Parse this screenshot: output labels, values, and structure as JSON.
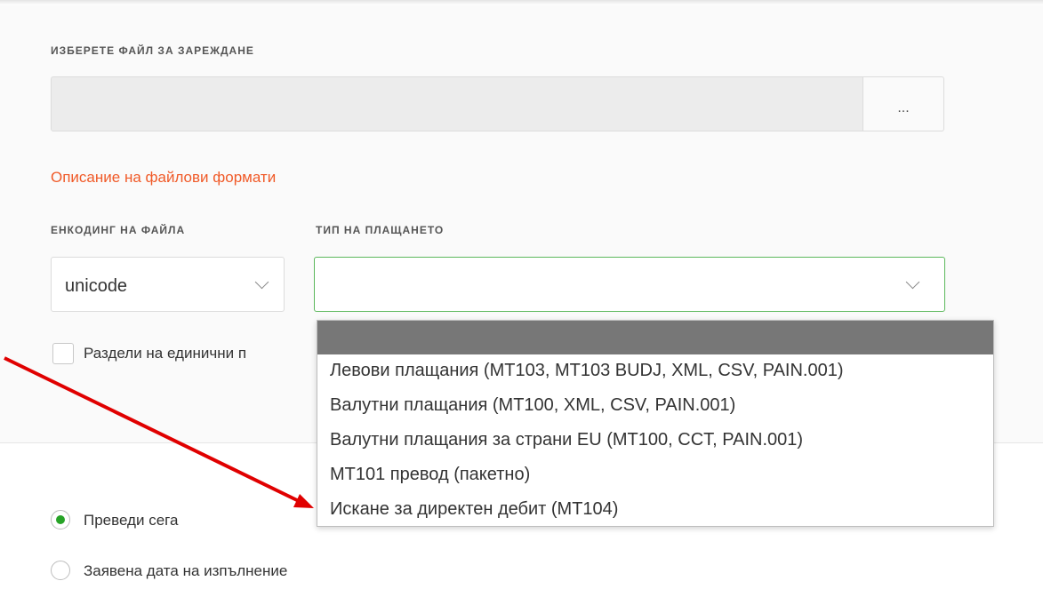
{
  "file_section": {
    "label": "ИЗБЕРЕТЕ ФАЙЛ ЗА ЗАРЕЖДАНЕ",
    "path_value": "",
    "browse_label": "..."
  },
  "format_link": "Описание на файлови формати",
  "encoding": {
    "label": "ЕНКОДИНГ НА ФАЙЛА",
    "value": "unicode"
  },
  "payment_type": {
    "label": "ТИП НА ПЛАЩАНЕТО",
    "value": "",
    "options": [
      "",
      "Левови плащания (MT103, MT103 BUDJ, XML, CSV, PAIN.001)",
      "Валутни плащания (MT100, XML, CSV, PAIN.001)",
      "Валутни плащания за страни EU (MT100, CCT, PAIN.001)",
      "MT101 превод (пакетно)",
      "Искане за директен дебит (MT104)"
    ]
  },
  "split_checkbox": {
    "label": "Раздели на единични п",
    "checked": false
  },
  "execution": {
    "options": [
      {
        "label": "Преведи сега",
        "selected": true
      },
      {
        "label": "Заявена дата на изпълнение",
        "selected": false
      }
    ]
  },
  "colors": {
    "accent_link": "#f05a28",
    "focus_border": "#5cb85c",
    "radio_selected": "#27a327",
    "annotation_arrow": "#e00000"
  }
}
